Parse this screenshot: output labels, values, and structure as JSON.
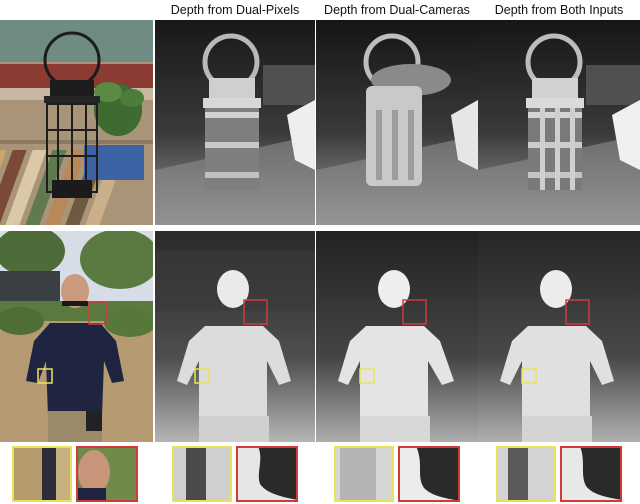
{
  "figure": {
    "column_headers": [
      "Depth from Dual-Pixels",
      "Depth from Dual-Cameras",
      "Depth from Both Inputs"
    ]
  },
  "colors": {
    "highlight_yellow": "#e8e35a",
    "highlight_red": "#d23a3a"
  }
}
